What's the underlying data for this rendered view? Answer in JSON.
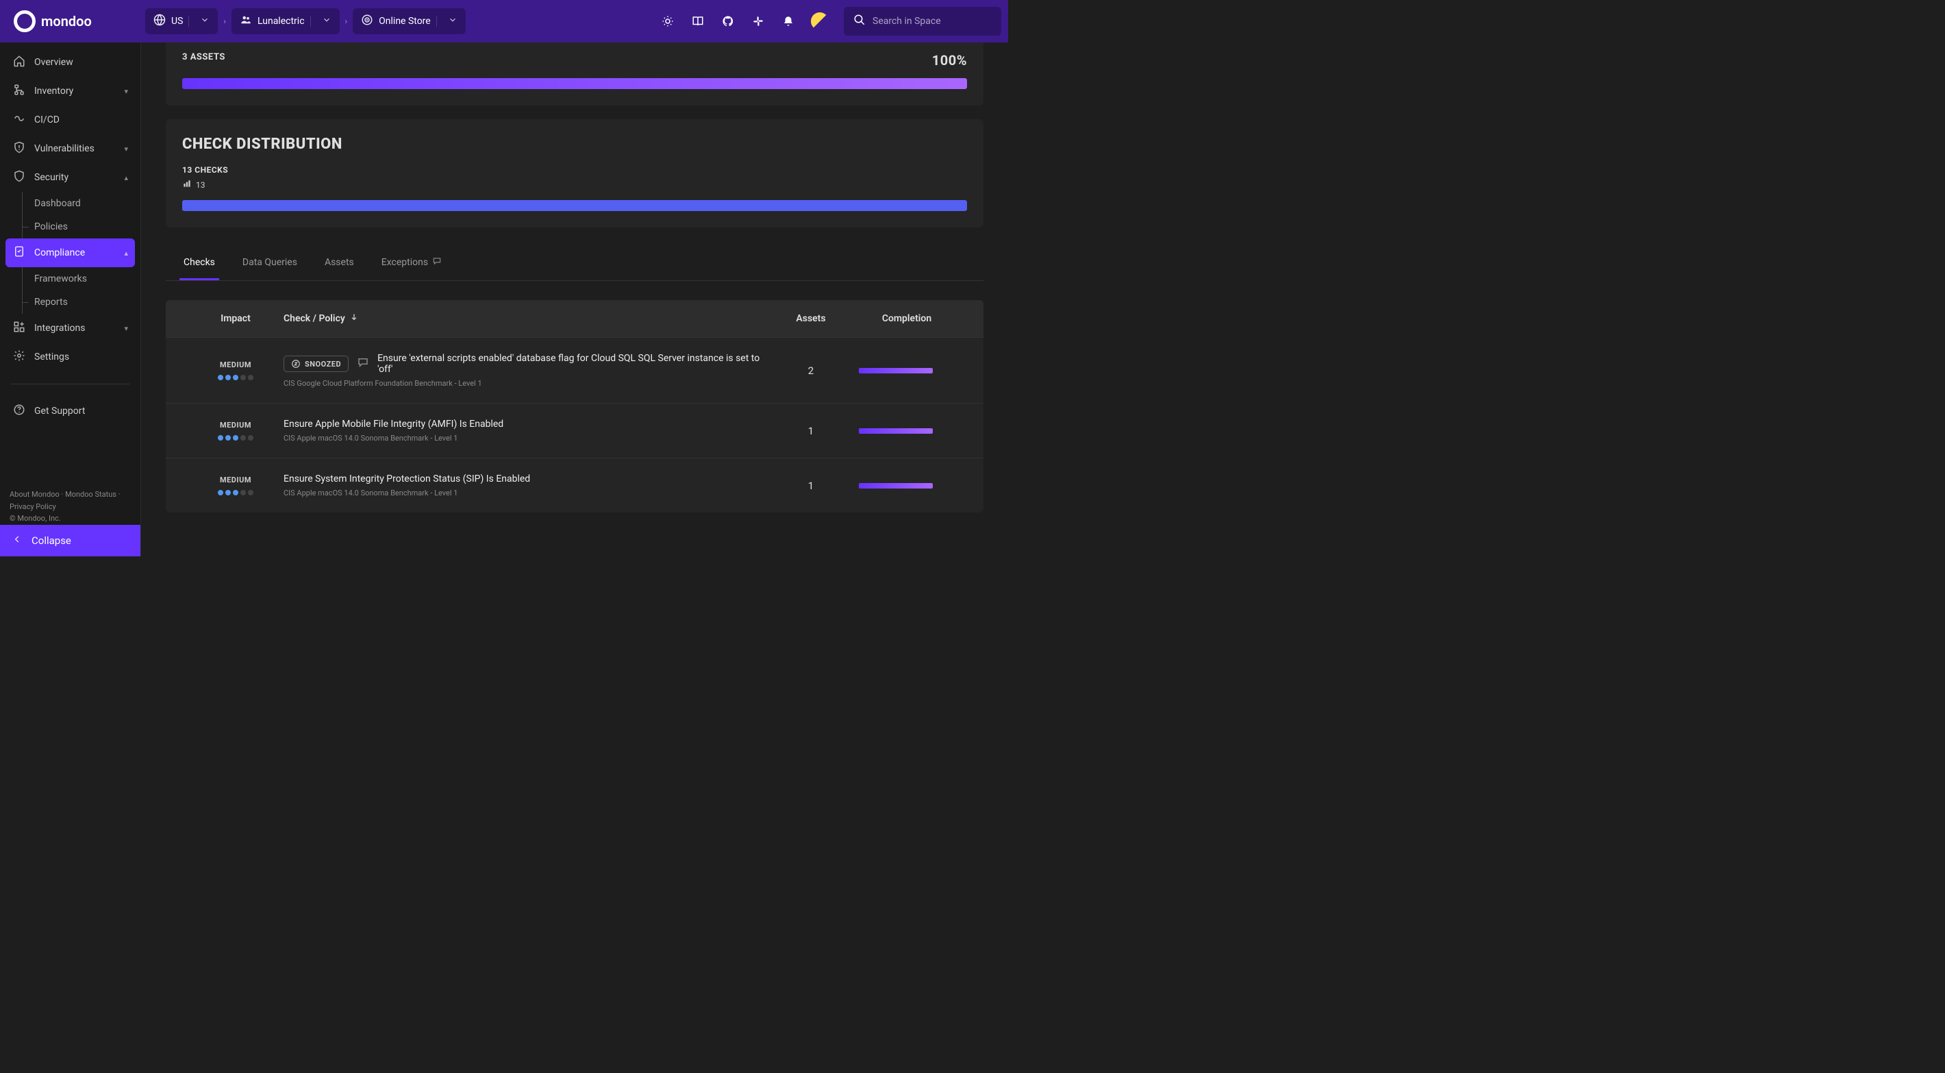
{
  "brand": "mondoo",
  "breadcrumbs": {
    "region": "US",
    "org": "Lunalectric",
    "space": "Online Store"
  },
  "search": {
    "placeholder": "Search in Space"
  },
  "sidebar": {
    "items": {
      "overview": "Overview",
      "inventory": "Inventory",
      "cicd": "CI/CD",
      "vulnerabilities": "Vulnerabilities",
      "security": "Security",
      "security_dashboard": "Dashboard",
      "security_policies": "Policies",
      "compliance": "Compliance",
      "compliance_frameworks": "Frameworks",
      "compliance_reports": "Reports",
      "integrations": "Integrations",
      "settings": "Settings",
      "support": "Get Support"
    },
    "footer": {
      "about": "About Mondoo",
      "status": "Mondoo Status",
      "privacy": "Privacy Policy",
      "copyright": "© Mondoo, Inc."
    },
    "collapse": "Collapse"
  },
  "main": {
    "assets_section": {
      "count_label": "3 ASSETS",
      "pct": "100%"
    },
    "check_dist": {
      "title": "CHECK DISTRIBUTION",
      "count_label": "13 CHECKS",
      "sub_value": "13"
    },
    "tabs": {
      "checks": "Checks",
      "data_queries": "Data Queries",
      "assets": "Assets",
      "exceptions": "Exceptions"
    },
    "table": {
      "headers": {
        "impact": "Impact",
        "check": "Check / Policy",
        "assets": "Assets",
        "completion": "Completion"
      },
      "rows": [
        {
          "impact": "MEDIUM",
          "snoozed": "SNOOZED",
          "has_snooze": true,
          "has_comment": true,
          "title": "Ensure 'external scripts enabled' database flag for Cloud SQL SQL Server instance is set to 'off'",
          "policy": "CIS Google Cloud Platform Foundation Benchmark - Level 1",
          "assets": "2"
        },
        {
          "impact": "MEDIUM",
          "has_snooze": false,
          "has_comment": false,
          "title": "Ensure Apple Mobile File Integrity (AMFI) Is Enabled",
          "policy": "CIS Apple macOS 14.0 Sonoma Benchmark - Level 1",
          "assets": "1"
        },
        {
          "impact": "MEDIUM",
          "has_snooze": false,
          "has_comment": false,
          "title": "Ensure System Integrity Protection Status (SIP) Is Enabled",
          "policy": "CIS Apple macOS 14.0 Sonoma Benchmark - Level 1",
          "assets": "1"
        }
      ]
    }
  }
}
